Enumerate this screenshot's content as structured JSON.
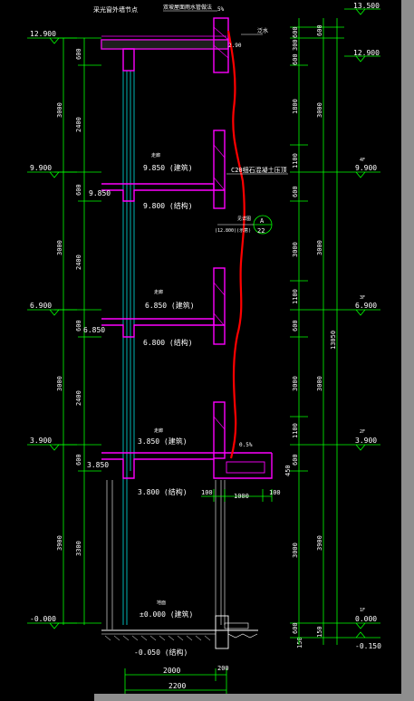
{
  "drawing": {
    "header_note": "采光窗外墙节点",
    "top_note": "双坡屋面雨水管做法",
    "slope_top": "5%",
    "slope_mid": "0.5%",
    "gutter_label": "泛水",
    "beam_label": "C20细石混凝土压顶",
    "callout": {
      "letter": "A",
      "number": "22"
    },
    "small_note": "(12.800)(示意)",
    "note_near_callout": "见详图"
  },
  "levels_left": [
    "12.900",
    "9.900",
    "6.900",
    "3.900",
    "-0.000"
  ],
  "levels_right": [
    "13.500",
    "12.900",
    "9.900",
    "6.900",
    "3.900",
    "0.000",
    "-0.150"
  ],
  "floor_tags_right": [
    "4F",
    "3F",
    "2F",
    "1F"
  ],
  "left_dims_outer": [
    "3000",
    "3000",
    "3000",
    "3900"
  ],
  "left_dims_inner": [
    "600",
    "2400",
    "600",
    "2400",
    "600",
    "2400",
    "600",
    "3300"
  ],
  "right_dims_inner": [
    "300",
    "600",
    "600",
    "1800",
    "1100",
    "600",
    "3000",
    "1100",
    "600",
    "3000",
    "1100",
    "600",
    "3000",
    "3000",
    "600"
  ],
  "right_dims_mid": [
    "600",
    "3000",
    "3000",
    "3000",
    "3900",
    "150"
  ],
  "right_total": "13050",
  "slab_labels": [
    {
      "top": "9.850 (建筑)",
      "bot": "9.800 (结构)",
      "side": "9.850",
      "tag": "走廊"
    },
    {
      "top": "6.850 (建筑)",
      "bot": "6.800 (结构)",
      "side": "6.850",
      "tag": "走廊"
    },
    {
      "top": "3.850 (建筑)",
      "bot": "3.800 (结构)",
      "side": "3.850",
      "tag": "走廊"
    },
    {
      "top": "±0.000 (建筑)",
      "bot": "",
      "side": "",
      "tag": "地面"
    }
  ],
  "roof_top_label": "2.90",
  "bottom": {
    "level": "-0.050 (结构)",
    "dim_2000": "2000",
    "dim_200": "200",
    "dim_2200": "2200",
    "dim_100a": "100",
    "dim_1000": "1000",
    "dim_100b": "100",
    "vert_450": "450",
    "vert_150": "150"
  },
  "colors": {
    "background": "#000000",
    "dimension": "#00ff00",
    "wall": "#ff00ff",
    "text": "#ffffff",
    "revision_cloud": "#ff0000",
    "window": "#00ffff",
    "frame": "#8e8e8e"
  }
}
